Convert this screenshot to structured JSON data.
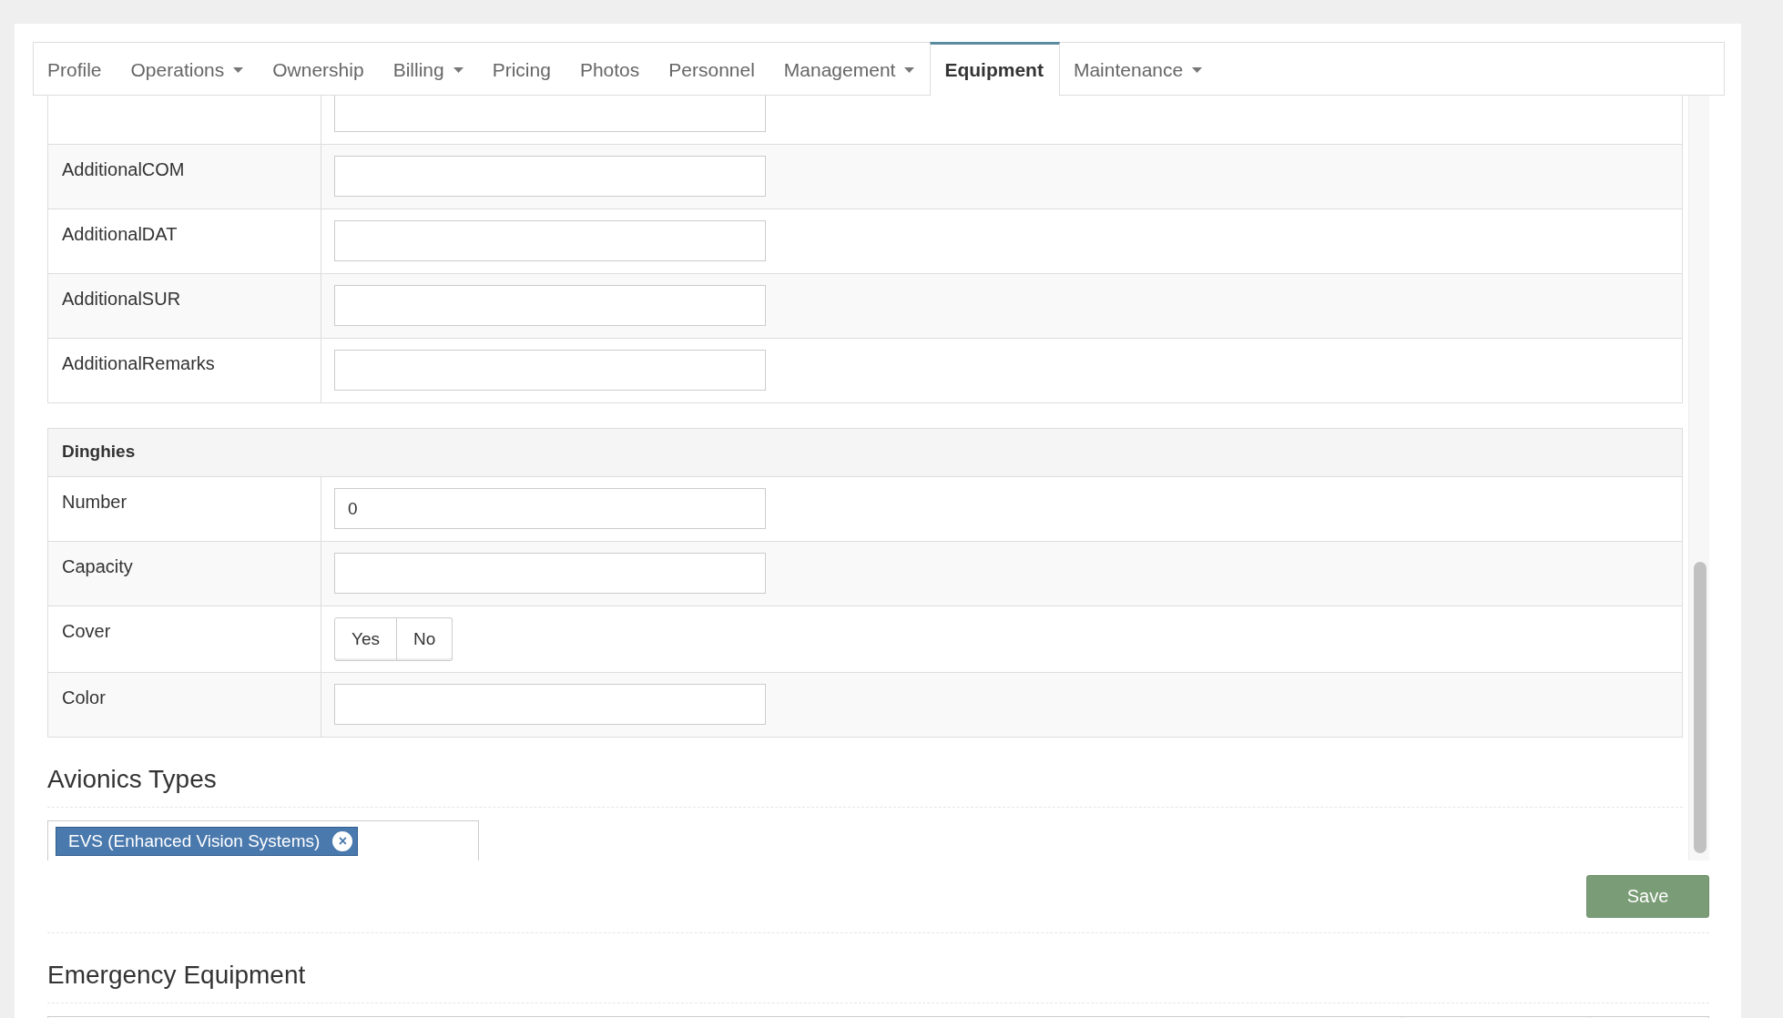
{
  "tabs": [
    {
      "label": "Profile",
      "dropdown": false,
      "selected": false
    },
    {
      "label": "Operations",
      "dropdown": true,
      "selected": false
    },
    {
      "label": "Ownership",
      "dropdown": false,
      "selected": false
    },
    {
      "label": "Billing",
      "dropdown": true,
      "selected": false
    },
    {
      "label": "Pricing",
      "dropdown": false,
      "selected": false
    },
    {
      "label": "Photos",
      "dropdown": false,
      "selected": false
    },
    {
      "label": "Personnel",
      "dropdown": false,
      "selected": false
    },
    {
      "label": "Management",
      "dropdown": true,
      "selected": false
    },
    {
      "label": "Equipment",
      "dropdown": false,
      "selected": true
    },
    {
      "label": "Maintenance",
      "dropdown": true,
      "selected": false
    }
  ],
  "additional_rows": [
    {
      "kind": "field",
      "value": ""
    },
    {
      "kind": "field",
      "label": "AdditionalCOM",
      "value": ""
    },
    {
      "kind": "field",
      "label": "AdditionalDAT",
      "value": ""
    },
    {
      "kind": "field",
      "label": "AdditionalSUR",
      "value": ""
    },
    {
      "kind": "field",
      "label": "AdditionalRemarks",
      "value": ""
    }
  ],
  "dinghies": {
    "title": "Dinghies",
    "rows": [
      {
        "kind": "field",
        "label": "Number",
        "value": "0"
      },
      {
        "kind": "field",
        "label": "Capacity",
        "value": ""
      },
      {
        "kind": "toggle",
        "label": "Cover",
        "options": [
          {
            "label": "Yes",
            "selected": false
          },
          {
            "label": "No",
            "selected": false
          }
        ]
      },
      {
        "kind": "field",
        "label": "Color",
        "value": ""
      }
    ]
  },
  "avionics": {
    "title": "Avionics Types",
    "tags": [
      "EVS (Enhanced Vision Systems)"
    ],
    "remove_symbol": "×"
  },
  "save_button": "Save",
  "emergency": {
    "title": "Emergency Equipment"
  }
}
